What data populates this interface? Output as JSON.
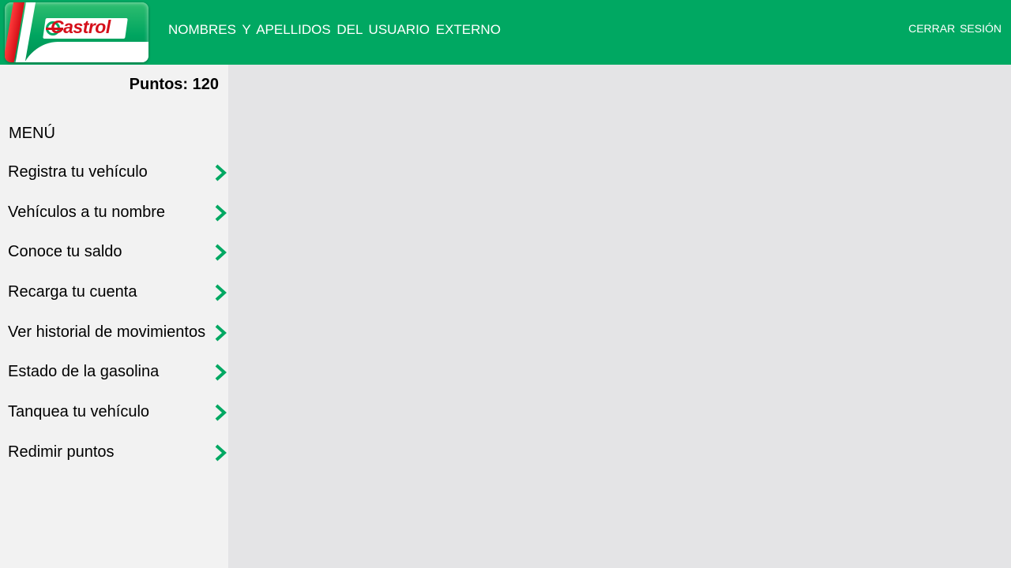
{
  "brand": {
    "logo_text": "Castrol",
    "accent_color": "#00a862",
    "logo_red": "#d50f1a"
  },
  "header": {
    "user_name": "NOMBRES  Y APELLIDOS  DEL  USUARIO  EXTERNO",
    "logout_label": "CERRAR  SESIÓN"
  },
  "sidebar": {
    "points_label": "Puntos: 120",
    "menu_title": "MENÚ",
    "items": [
      {
        "label": "Registra tu vehículo",
        "icon": "chevron-right-icon"
      },
      {
        "label": "Vehículos  a tu nombre",
        "icon": "chevron-right-icon"
      },
      {
        "label": "Conoce  tu saldo",
        "icon": "chevron-right-icon"
      },
      {
        "label": "Recarga tu cuenta",
        "icon": "chevron-right-icon"
      },
      {
        "label": "Ver historial de movimientos",
        "icon": "chevron-right-icon"
      },
      {
        "label": "Estado de la gasolina",
        "icon": "chevron-right-icon"
      },
      {
        "label": "Tanquea  tu vehículo",
        "icon": "chevron-right-icon"
      },
      {
        "label": "Redimir  puntos",
        "icon": "chevron-right-icon"
      }
    ]
  }
}
